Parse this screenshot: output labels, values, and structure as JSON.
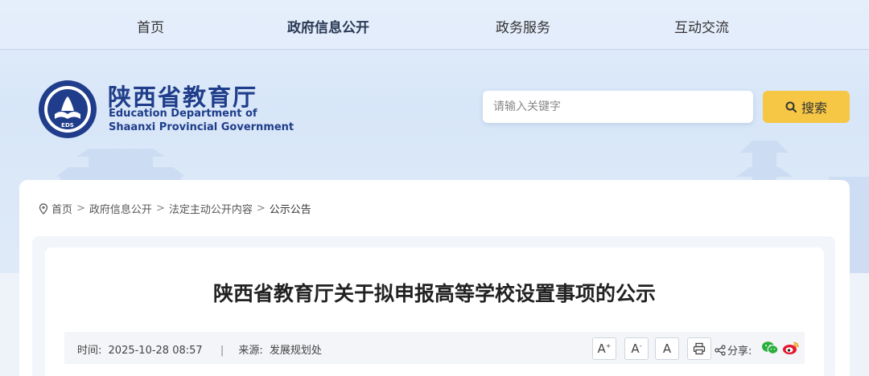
{
  "nav": {
    "items": [
      {
        "label": "首页"
      },
      {
        "label": "政府信息公开"
      },
      {
        "label": "政务服务"
      },
      {
        "label": "互动交流"
      }
    ]
  },
  "logo": {
    "cn": "陕西省教育厅",
    "en_line1": "Education Department of",
    "en_line2": "Shaanxi Provincial Government",
    "emblem_text": "EDS"
  },
  "search": {
    "placeholder": "请输入关键字",
    "button_label": "搜索"
  },
  "breadcrumb": {
    "items": [
      "首页",
      "政府信息公开",
      "法定主动公开内容",
      "公示公告"
    ]
  },
  "article": {
    "title": "陕西省教育厅关于拟申报高等学校设置事项的公示",
    "time_label": "时间:",
    "time_value": "2025-10-28 08:57",
    "source_label": "来源:",
    "source_value": "发展规划处",
    "font_large": "A",
    "font_medium": "A",
    "font_small": "A",
    "share_label": "分享:"
  },
  "colors": {
    "brand": "#1f3d8a",
    "search_button": "#f6c744",
    "wechat": "#2aae3b",
    "weibo": "#e6162d"
  },
  "icons": {
    "location": "location-pin-icon",
    "search": "search-icon",
    "print": "printer-icon",
    "share": "share-icon",
    "wechat": "wechat-icon",
    "weibo": "weibo-icon"
  }
}
